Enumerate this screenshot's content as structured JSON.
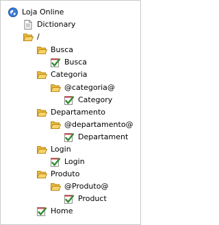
{
  "tree": {
    "nodes": [
      {
        "label": "Loja Online",
        "icon": "site-globe-icon"
      },
      {
        "label": "Dictionary",
        "icon": "document-icon"
      },
      {
        "label": "/",
        "icon": "folder-open-icon"
      },
      {
        "label": "Busca",
        "icon": "folder-open-icon"
      },
      {
        "label": "Busca",
        "icon": "checked-page-icon"
      },
      {
        "label": "Categoria",
        "icon": "folder-open-icon"
      },
      {
        "label": "@categoria@",
        "icon": "folder-open-icon"
      },
      {
        "label": "Category",
        "icon": "checked-page-icon"
      },
      {
        "label": "Departamento",
        "icon": "folder-open-icon"
      },
      {
        "label": "@departamento@",
        "icon": "folder-open-icon"
      },
      {
        "label": "Departament",
        "icon": "checked-page-icon"
      },
      {
        "label": "Login",
        "icon": "folder-open-icon"
      },
      {
        "label": "Login",
        "icon": "checked-page-icon"
      },
      {
        "label": "Produto",
        "icon": "folder-open-icon"
      },
      {
        "label": "@Produto@",
        "icon": "folder-open-icon"
      },
      {
        "label": "Product",
        "icon": "checked-page-icon"
      },
      {
        "label": "Home",
        "icon": "checked-page-icon"
      }
    ]
  },
  "colors": {
    "folder": "#f2c24a",
    "check": "#2e8b2e",
    "globe": "#2a6fcf",
    "border": "#c8c8c8"
  }
}
